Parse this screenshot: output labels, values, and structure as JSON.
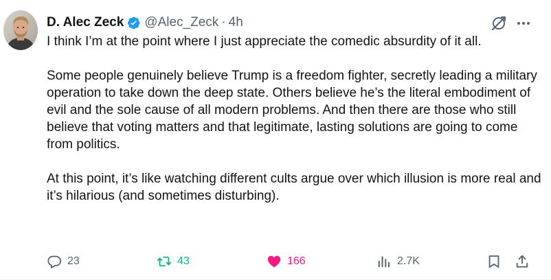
{
  "tweet": {
    "author": {
      "display_name": "D. Alec Zeck",
      "handle": "@Alec_Zeck",
      "verified": true
    },
    "separator": "·",
    "timestamp": "4h",
    "paragraphs": [
      "I think I’m at the point where I just appreciate the comedic absurdity of it all.",
      "Some people genuinely believe Trump is a freedom fighter, secretly leading a military operation to take down the deep state. Others believe he’s the literal embodiment of evil and the sole cause of all modern problems. And then there are those who still believe that voting matters and that legitimate, lasting solutions are going to come from politics.",
      "At this point, it’s like watching different cults argue over which illusion is more real and it’s hilarious (and sometimes disturbing)."
    ],
    "metrics": {
      "replies": "23",
      "retweets": "43",
      "likes": "166",
      "views": "2.7K"
    },
    "liked": true,
    "retweeted": true
  },
  "colors": {
    "verified_blue": "#1d9bf0",
    "retweet_green": "#00ba7c",
    "like_pink": "#f91880",
    "muted_gray": "#536471",
    "text": "#0f1419"
  },
  "icons": {
    "avatar": "avatar",
    "verified": "verified-badge-icon",
    "grok": "grok-icon",
    "more": "more-icon",
    "reply": "reply-icon",
    "retweet": "retweet-icon",
    "like": "heart-icon",
    "views": "views-icon",
    "bookmark": "bookmark-icon",
    "share": "share-icon"
  }
}
